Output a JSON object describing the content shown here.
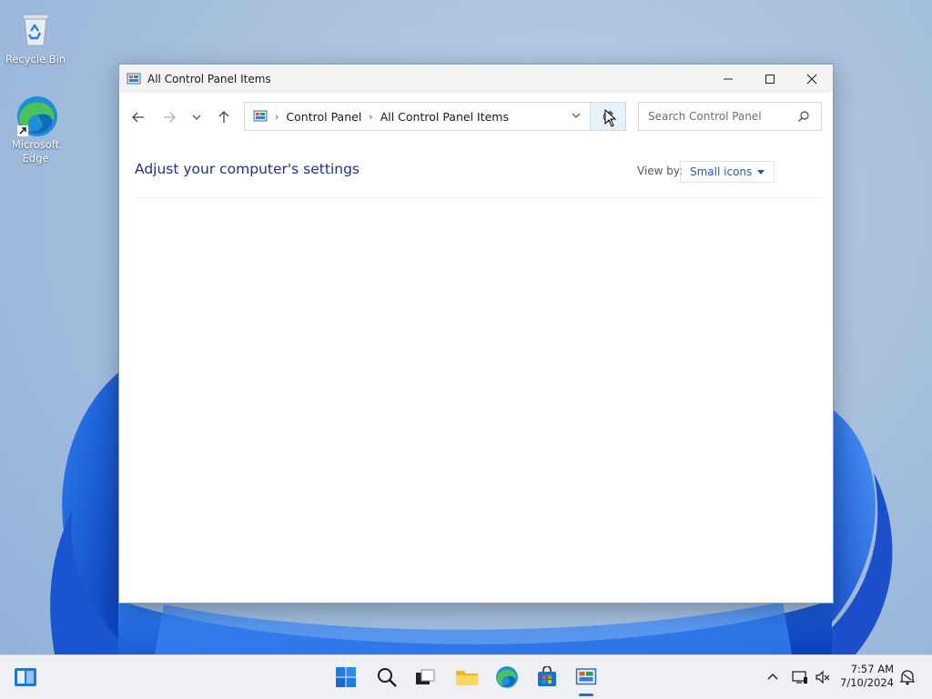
{
  "desktop": {
    "icons": [
      {
        "label": "Recycle Bin"
      },
      {
        "label_line1": "Microsoft",
        "label_line2": "Edge"
      }
    ]
  },
  "window": {
    "title": "All Control Panel Items",
    "breadcrumbs": [
      "Control Panel",
      "All Control Panel Items"
    ],
    "search_placeholder": "Search Control Panel",
    "heading": "Adjust your computer's settings",
    "view_by_label": "View by:",
    "view_by_value": "Small icons"
  },
  "taskbar": {
    "time": "7:57 AM",
    "date": "7/10/2024"
  },
  "colors": {
    "accent": "#2a6bd8",
    "heading": "#1e3287",
    "link": "#1e5aa8"
  }
}
